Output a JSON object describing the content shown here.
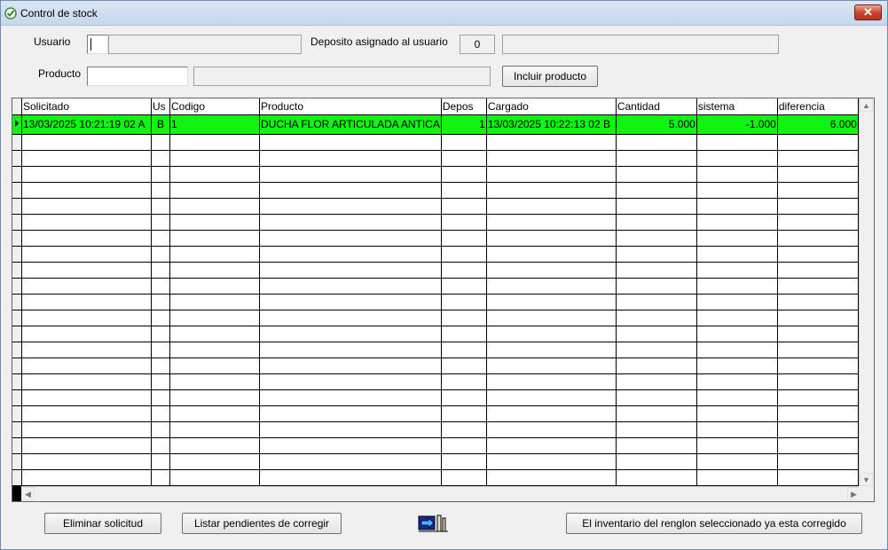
{
  "window": {
    "title": "Control de stock",
    "close_label": "✕"
  },
  "form": {
    "usuario_label": "Usuario",
    "usuario_code": "",
    "usuario_name": "",
    "deposito_label": "Deposito asignado al usuario",
    "deposito_value": "0",
    "deposito_name": "",
    "producto_label": "Producto",
    "producto_code": "",
    "producto_name": "",
    "incluir_label": "Incluir producto"
  },
  "grid": {
    "columns": [
      "Solicitado",
      "Us",
      "Codigo",
      "Producto",
      "Depos",
      "Cargado",
      "Cantidad",
      "sistema",
      "diferencia"
    ],
    "rows": [
      [
        "13/03/2025 10:21:19 02 A",
        "B",
        "1",
        "DUCHA FLOR ARTICULADA ANTICA",
        "1",
        "13/03/2025 10:22:13 02 B",
        "5.000",
        "-1.000",
        "6.000"
      ]
    ],
    "selected_row_color": "#12f312"
  },
  "buttons": {
    "eliminar": "Eliminar solicitud",
    "listar": "Listar pendientes de corregir",
    "corregido": "El inventario del renglon seleccionado ya esta corregido"
  },
  "icons": [
    "app-icon",
    "export-icon"
  ]
}
